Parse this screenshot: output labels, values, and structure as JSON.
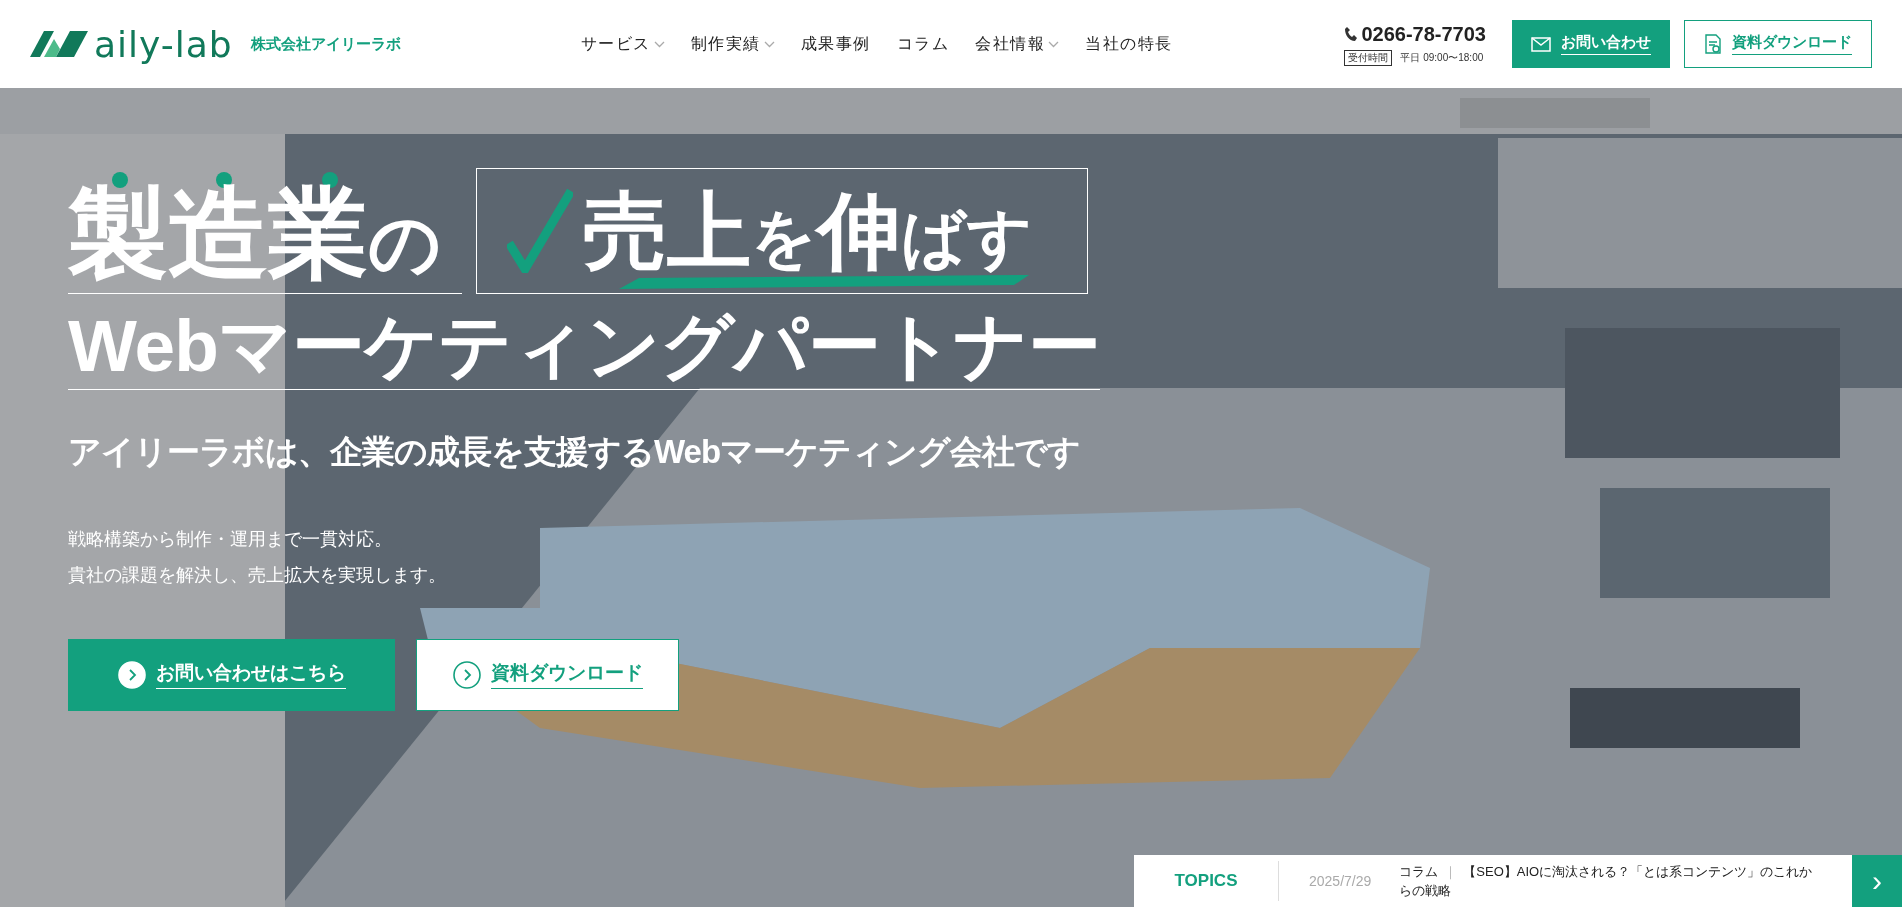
{
  "header": {
    "logo": "aily-lab",
    "company": "株式会社アイリーラボ",
    "nav": [
      {
        "label": "サービス",
        "dropdown": true
      },
      {
        "label": "制作実績",
        "dropdown": true
      },
      {
        "label": "成果事例",
        "dropdown": false
      },
      {
        "label": "コラム",
        "dropdown": false
      },
      {
        "label": "会社情報",
        "dropdown": true
      },
      {
        "label": "当社の特長",
        "dropdown": false
      }
    ],
    "phone": "0266-78-7703",
    "hours_label": "受付時間",
    "hours": "平日 09:00〜18:00",
    "contact_button": "お問い合わせ",
    "download_button": "資料ダウンロード"
  },
  "hero": {
    "line1": [
      {
        "text": "製造業",
        "large": true
      },
      {
        "text": "の",
        "large": false
      }
    ],
    "boxed": [
      {
        "text": "売上",
        "large": true
      },
      {
        "text": "を",
        "large": false
      },
      {
        "text": "伸",
        "large": true
      },
      {
        "text": "ばす",
        "large": false
      }
    ],
    "line2": "Webマーケティングパートナー",
    "subtitle": "アイリーラボは、企業の成長を支援するWebマーケティング会社です",
    "lines": [
      "戦略構築から制作・運用まで一貫対応。",
      "貴社の課題を解決し、売上拡大を実現します。"
    ],
    "buttons": [
      {
        "label": "お問い合わせはこちら",
        "kind": "filled"
      },
      {
        "label": "資料ダウンロード",
        "kind": "outline"
      }
    ]
  },
  "topics": {
    "label": "TOPICS",
    "date": "2025/7/29",
    "category": "コラム",
    "separator": "｜",
    "title": "【SEO】AIOに淘汰される？「とは系コンテンツ」のこれからの戦略",
    "arrow": "›"
  }
}
